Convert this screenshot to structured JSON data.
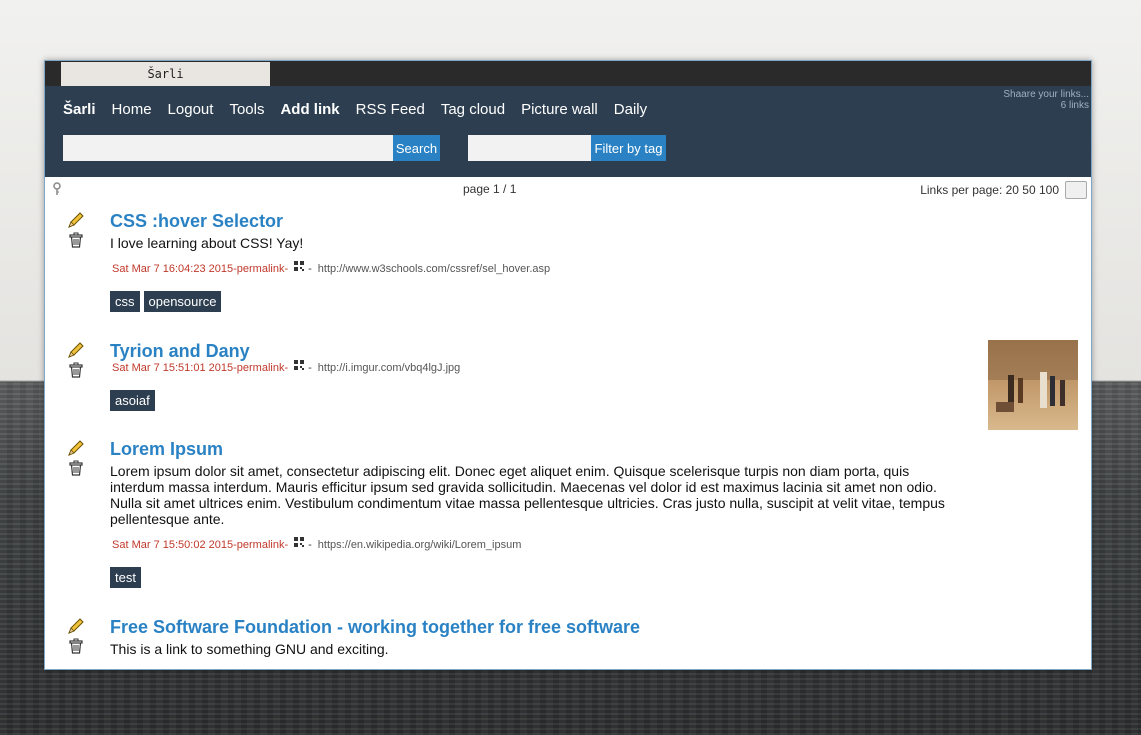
{
  "tab": {
    "title": "Šarli"
  },
  "header": {
    "nav": [
      "Šarli",
      "Home",
      "Logout",
      "Tools",
      "Add link",
      "RSS Feed",
      "Tag cloud",
      "Picture wall",
      "Daily"
    ],
    "tagline": "Shaare your links...",
    "count": "6 links",
    "search_label": "Search",
    "filter_label": "Filter by tag"
  },
  "pager": {
    "page": "page 1 / 1",
    "per_page": "Links per page: 20 50 100"
  },
  "links": [
    {
      "title": "CSS :hover Selector",
      "description": "I love learning about CSS! Yay!",
      "date": "Sat Mar 7 16:04:23 2015",
      "permalink": "permalink",
      "url": "http://www.w3schools.com/cssref/sel_hover.asp",
      "tags": [
        "css",
        "opensource"
      ]
    },
    {
      "title": "Tyrion and Dany",
      "description": "",
      "date": "Sat Mar 7 15:51:01 2015",
      "permalink": "permalink",
      "url": "http://i.imgur.com/vbq4lgJ.jpg",
      "tags": [
        "asoiaf"
      ]
    },
    {
      "title": "Lorem Ipsum",
      "description": "Lorem ipsum dolor sit amet, consectetur adipiscing elit. Donec eget aliquet enim. Quisque scelerisque turpis non diam porta, quis interdum massa interdum. Mauris efficitur ipsum sed gravida sollicitudin. Maecenas vel dolor id est maximus lacinia sit amet non odio. Nulla sit amet ultrices enim. Vestibulum condimentum vitae massa pellentesque ultricies. Cras justo nulla, suscipit at velit vitae, tempus pellentesque ante.",
      "date": "Sat Mar 7 15:50:02 2015",
      "permalink": "permalink",
      "url": "https://en.wikipedia.org/wiki/Lorem_ipsum",
      "tags": [
        "test"
      ]
    },
    {
      "title": "Free Software Foundation - working together for free software",
      "description": "This is a link to something GNU and exciting."
    }
  ],
  "meta_separator": " - ",
  "icons": {
    "edit": "pencil-icon",
    "delete": "trash-icon",
    "qrcode": "qrcode-icon",
    "key": "key-icon"
  },
  "colors": {
    "header": "#2c3e50",
    "accent": "#2a82c4",
    "date": "#c0392b"
  }
}
